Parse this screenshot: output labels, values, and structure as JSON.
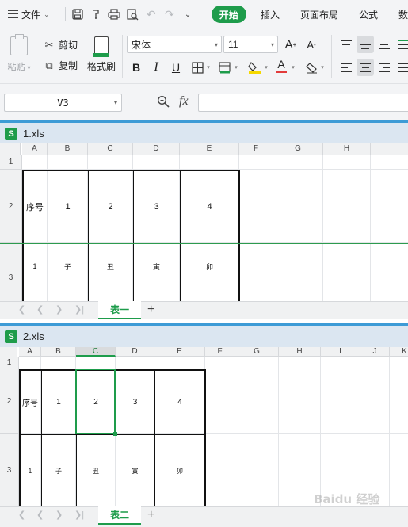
{
  "menubar": {
    "file_label": "文件",
    "tabs": [
      {
        "label": "开始",
        "active": true
      },
      {
        "label": "插入",
        "active": false
      },
      {
        "label": "页面布局",
        "active": false
      },
      {
        "label": "公式",
        "active": false
      },
      {
        "label": "数",
        "active": false
      }
    ]
  },
  "ribbon": {
    "paste_label": "粘贴",
    "cut_label": "剪切",
    "copy_label": "复制",
    "format_painter_label": "格式刷",
    "font_name": "宋体",
    "font_size": "11",
    "bold_label": "B",
    "italic_label": "I",
    "underline_label": "U",
    "font_color_letter": "A",
    "accent_color": "#1e9c4b"
  },
  "formulabar": {
    "cell_ref": "V3",
    "fx_label": "fx",
    "formula_value": ""
  },
  "workbooks": [
    {
      "filename": "1.xls",
      "columns": [
        "A",
        "B",
        "C",
        "D",
        "E",
        "F",
        "G",
        "H",
        "I"
      ],
      "rows": [
        "1",
        "2",
        "3"
      ],
      "header_row": [
        "序号",
        "1",
        "2",
        "3",
        "4"
      ],
      "data_row": [
        "1",
        "子",
        "丑",
        "寅",
        "卯"
      ],
      "sheet_tab": "表一",
      "selected_column": ""
    },
    {
      "filename": "2.xls",
      "columns": [
        "A",
        "B",
        "C",
        "D",
        "E",
        "F",
        "G",
        "H",
        "I",
        "J",
        "K"
      ],
      "rows": [
        "1",
        "2",
        "3"
      ],
      "header_row": [
        "序号",
        "1",
        "2",
        "3",
        "4"
      ],
      "data_row": [
        "1",
        "子",
        "丑",
        "寅",
        "卯"
      ],
      "sheet_tab": "表二",
      "selected_column": "C"
    }
  ],
  "watermark": "Baidu 经验"
}
